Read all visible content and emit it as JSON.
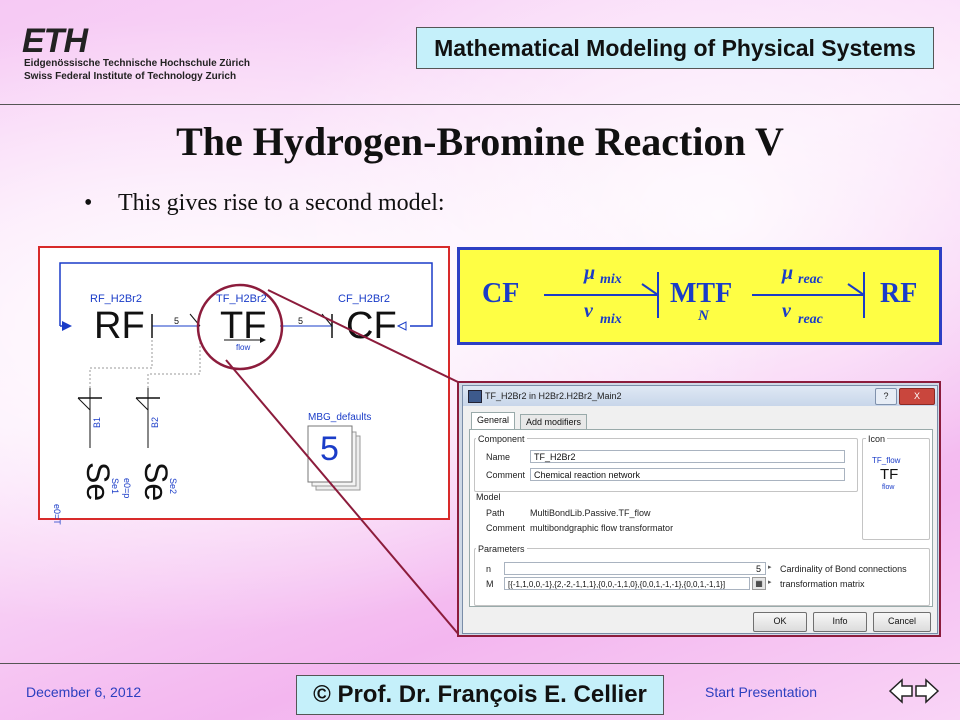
{
  "header": {
    "logo": "ETH",
    "institution_de": "Eidgenössische Technische Hochschule Zürich",
    "institution_en": "Swiss Federal Institute of Technology Zurich",
    "course": "Mathematical Modeling of Physical Systems"
  },
  "slide": {
    "title": "The Hydrogen-Bromine Reaction V",
    "bullet": "•",
    "bullet_text": "This gives rise to a second model:"
  },
  "diagram": {
    "rf_label": "RF_H2Br2",
    "tf_label": "TF_H2Br2",
    "cf_label": "CF_H2Br2",
    "rf_big": "RF",
    "tf_big": "TF",
    "cf_big": "CF",
    "bond1": "5",
    "bond2": "5",
    "flow": "flow",
    "b1": "B1",
    "b2": "B2",
    "se": "Se",
    "se1": "Se1",
    "se2": "Se2",
    "e0t": "e0=T",
    "e0p": "e0=p",
    "mbg_label": "MBG_defaults",
    "mbg_value": "5"
  },
  "bondgraph": {
    "cf": "CF",
    "mtf": "MTF",
    "rf": "RF",
    "mu": "μ",
    "nu": "ν",
    "mix": "mix",
    "reac": "reac",
    "n": "N"
  },
  "dialog": {
    "title": "TF_H2Br2 in H2Br2.H2Br2_Main2",
    "help": "?",
    "close": "X",
    "tabs": [
      "General",
      "Add modifiers"
    ],
    "component_label": "Component",
    "icon_label": "Icon",
    "name_label": "Name",
    "name_value": "TF_H2Br2",
    "comment_label": "Comment",
    "comment_value": "Chemical reaction network",
    "icon_tf": "TF",
    "icon_flow_top": "TF_flow",
    "icon_flow_bottom": "flow",
    "model_label": "Model",
    "path_label": "Path",
    "path_value": "MultiBondLib.Passive.TF_flow",
    "model_comment_label": "Comment",
    "model_comment_value": "multibondgraphic flow transformator",
    "parameters_label": "Parameters",
    "n_label": "n",
    "n_value": "5",
    "n_desc": "Cardinality of Bond connections",
    "m_label": "M",
    "m_value": "[{-1,1,0,0,-1},{2,-2,-1,1,1},{0,0,-1,1,0},{0,0,1,-1,-1},{0,0,1,-1,1}]",
    "m_desc": "transformation matrix",
    "ok": "OK",
    "info": "Info",
    "cancel": "Cancel"
  },
  "footer": {
    "date": "December 6, 2012",
    "credit": "© Prof. Dr. François E. Cellier",
    "start": "Start Presentation"
  },
  "colors": {
    "title_box": "#c5f0fa",
    "diagram_border": "#d82a2a",
    "bondgraph_fill": "#fefe44",
    "bondgraph_text": "#1a3cc8",
    "zoom_line": "#8c1c3c"
  }
}
